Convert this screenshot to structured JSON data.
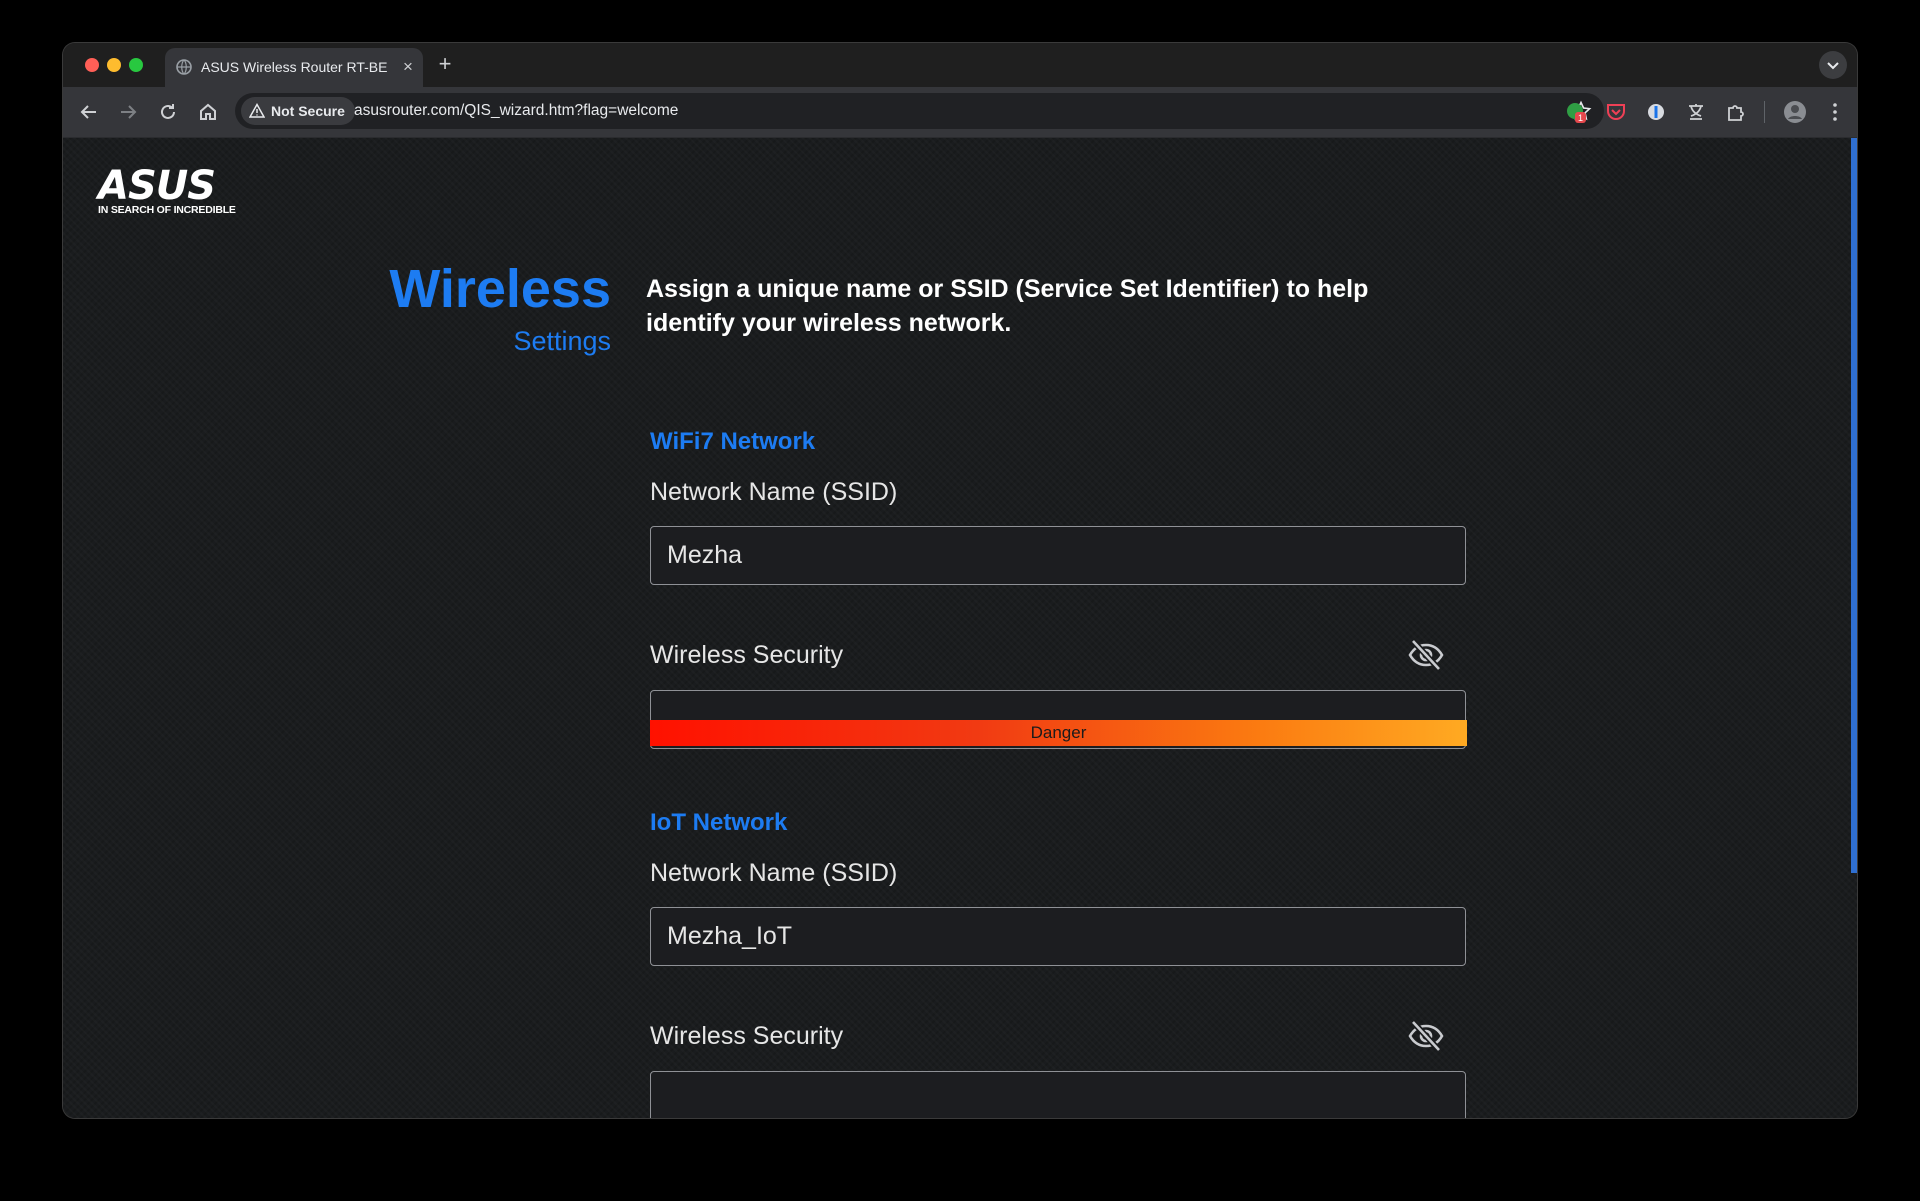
{
  "browser": {
    "tab_title": "ASUS Wireless Router RT-BE",
    "tab_close": "×",
    "new_tab": "+",
    "security_chip": "Not Secure",
    "url": "asusrouter.com/QIS_wizard.htm?flag=welcome",
    "extension_badge": "1"
  },
  "logo": {
    "wordmark": "ASUS",
    "tagline": "IN SEARCH OF INCREDIBLE"
  },
  "header": {
    "title": "Wireless",
    "subtitle": "Settings",
    "description": "Assign a unique name or SSID (Service Set Identifier) to help identify your wireless network."
  },
  "wifi7": {
    "section_title": "WiFi7 Network",
    "ssid_label": "Network Name (SSID)",
    "ssid_value": "Mezha",
    "security_label": "Wireless Security",
    "security_value": "",
    "strength_text": "Danger"
  },
  "iot": {
    "section_title": "IoT Network",
    "ssid_label": "Network Name (SSID)",
    "ssid_value": "Mezha_IoT",
    "security_label": "Wireless Security",
    "security_value": ""
  },
  "colors": {
    "accent": "#1d7cf2",
    "danger_start": "#ff1100",
    "danger_end": "#ffaa22"
  }
}
